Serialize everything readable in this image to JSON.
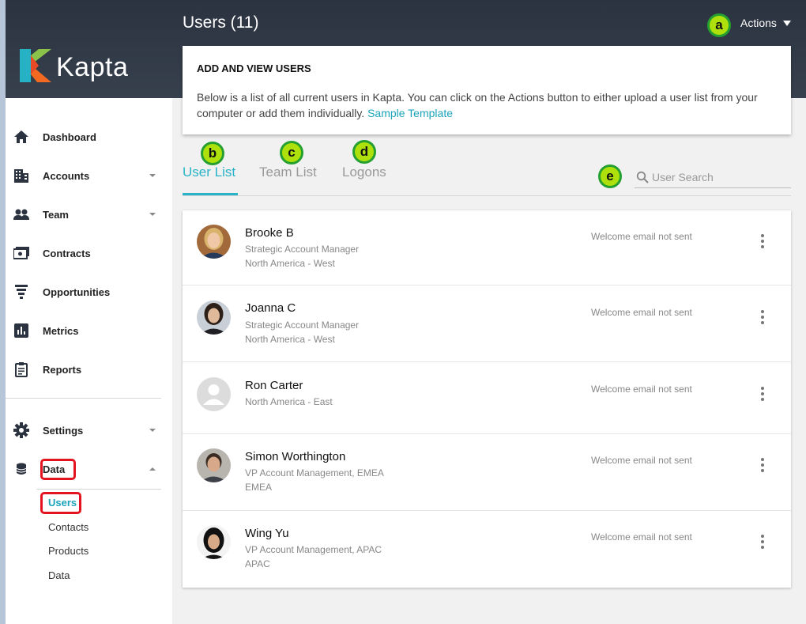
{
  "app": {
    "brand": "Kapta"
  },
  "header": {
    "title": "Users (11)",
    "actions_label": "Actions"
  },
  "sidebar": {
    "items": [
      {
        "label": "Dashboard",
        "icon": "home-icon"
      },
      {
        "label": "Accounts",
        "icon": "building-icon"
      },
      {
        "label": "Team",
        "icon": "people-icon"
      },
      {
        "label": "Contracts",
        "icon": "money-icon"
      },
      {
        "label": "Opportunities",
        "icon": "funnel-icon"
      },
      {
        "label": "Metrics",
        "icon": "bar-chart-icon"
      },
      {
        "label": "Reports",
        "icon": "clipboard-icon"
      },
      {
        "label": "Settings",
        "icon": "gear-icon"
      },
      {
        "label": "Data",
        "icon": "database-icon"
      }
    ],
    "sub_items": [
      {
        "label": "Users",
        "active": true
      },
      {
        "label": "Contacts"
      },
      {
        "label": "Products"
      },
      {
        "label": "Data"
      }
    ]
  },
  "info": {
    "heading": "ADD AND VIEW USERS",
    "description": "Below is a list of all current users in Kapta. You can click on the Actions button to either upload a user list from your computer or add them individually.",
    "link": "Sample Template"
  },
  "tabs": [
    {
      "label": "User List",
      "active": true
    },
    {
      "label": "Team List"
    },
    {
      "label": "Logons"
    }
  ],
  "search": {
    "placeholder": "User Search",
    "value": ""
  },
  "users": [
    {
      "name": "Brooke B",
      "role": "Strategic Account Manager",
      "region": "North America - West",
      "status": "Welcome email not sent"
    },
    {
      "name": "Joanna C",
      "role": "Strategic Account Manager",
      "region": "North America - West",
      "status": "Welcome email not sent"
    },
    {
      "name": "Ron Carter",
      "role": "",
      "region": "North America - East",
      "status": "Welcome email not sent"
    },
    {
      "name": "Simon Worthington",
      "role": "VP Account Management, EMEA",
      "region": "EMEA",
      "status": "Welcome email not sent"
    },
    {
      "name": "Wing Yu",
      "role": "VP Account Management, APAC",
      "region": "APAC",
      "status": "Welcome email not sent"
    }
  ],
  "annotations": {
    "a": "a",
    "b": "b",
    "c": "c",
    "d": "d",
    "e": "e"
  },
  "colors": {
    "accent": "#29b3c9",
    "header_bg": "#2f3845",
    "highlight_box": "#e3141f",
    "marker_fill": "#aee10c",
    "marker_ring": "#25a030"
  }
}
